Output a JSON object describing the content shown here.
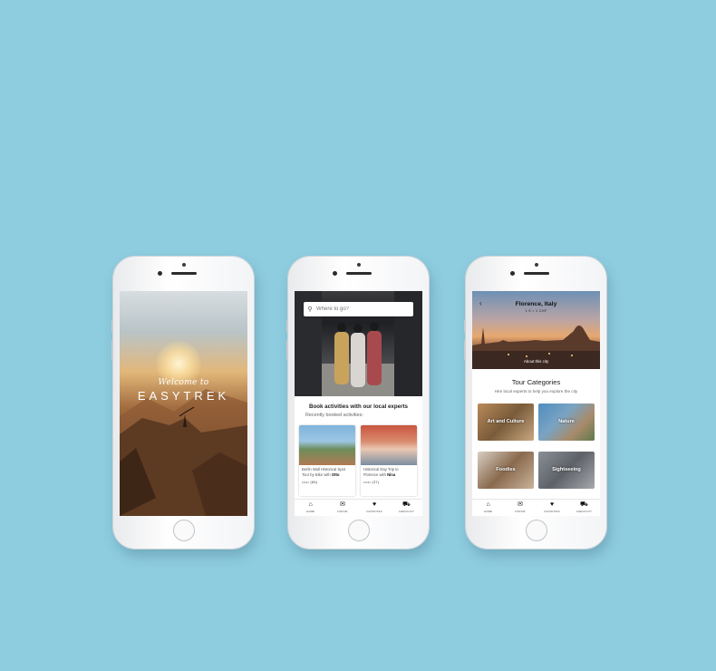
{
  "colors": {
    "background": "#8ecde0",
    "phone_body": "#f3f4f6",
    "text_dark": "#222222"
  },
  "splash": {
    "welcome": "Welcome to",
    "brand": "EASYTREK"
  },
  "home": {
    "search_placeholder": "Where to go?",
    "heading": "Book activities with our local experts",
    "subheading": "Recently booked activities:",
    "cards": [
      {
        "title_pre": "Berlin Wall Historical Spot Tour by Bike with ",
        "guide": "Otto",
        "rating": "••••• (65)"
      },
      {
        "title_pre": "Historical Day Trip to Florence with ",
        "guide": "Nina",
        "rating": "••••• (37)"
      }
    ]
  },
  "city": {
    "name": "Florence, Italy",
    "currency": "1 € = 1 CHF",
    "about": "About this city",
    "categories_title": "Tour Categories",
    "categories_subtitle": "Hire local experts to help you explore the city",
    "categories": [
      "Art and Culture",
      "Nature",
      "Foodies",
      "Sightseeing"
    ]
  },
  "nav": {
    "items": [
      {
        "icon": "home-icon",
        "glyph": "⌂",
        "label": "HOME"
      },
      {
        "icon": "chat-icon",
        "glyph": "✉",
        "label": "FORUM"
      },
      {
        "icon": "heart-icon",
        "glyph": "♥",
        "label": "FAVORITES"
      },
      {
        "icon": "cart-icon",
        "glyph": "⛟",
        "label": "CHECKOUT"
      }
    ]
  }
}
